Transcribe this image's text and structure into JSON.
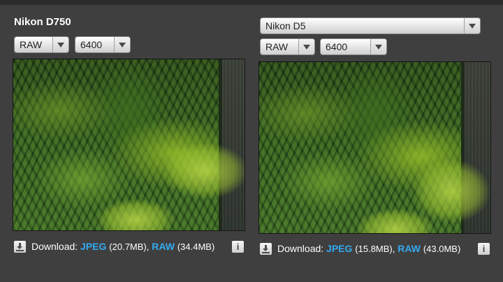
{
  "left": {
    "title": "Nikon D750",
    "format": "RAW",
    "iso": "6400",
    "download": {
      "label": "Download:",
      "jpeg_label": "JPEG",
      "jpeg_size": "(20.7MB),",
      "raw_label": "RAW",
      "raw_size": "(34.4MB)"
    },
    "info_label": "i"
  },
  "right": {
    "camera": "Nikon D5",
    "format": "RAW",
    "iso": "6400",
    "download": {
      "label": "Download:",
      "jpeg_label": "JPEG",
      "jpeg_size": "(15.8MB),",
      "raw_label": "RAW",
      "raw_size": "(43.0MB)"
    },
    "info_label": "i"
  },
  "colors": {
    "background": "#3f3f3f",
    "link": "#33aaf0"
  },
  "icons": {
    "download": "download-icon",
    "info": "info-icon",
    "dropdown": "chevron-down-icon"
  }
}
